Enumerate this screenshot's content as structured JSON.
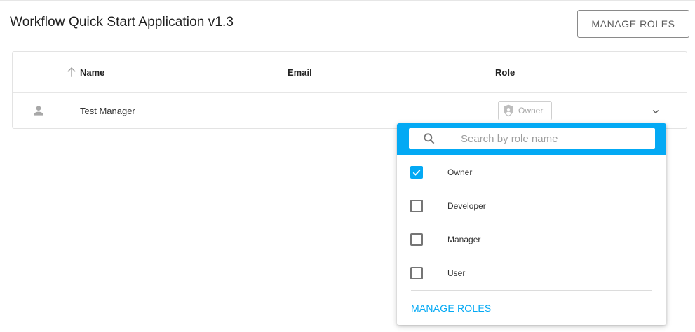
{
  "header": {
    "title": "Workflow Quick Start Application v1.3",
    "manage_roles_label": "MANAGE ROLES"
  },
  "table": {
    "columns": [
      "Name",
      "Email",
      "Role"
    ],
    "sort": {
      "column": "Name",
      "direction": "ascending",
      "icon": "arrow-up-icon"
    },
    "rows": [
      {
        "avatar_icon": "person-icon",
        "name": "Test Manager",
        "email": "",
        "role": "Owner",
        "role_icon": "shield-person-icon"
      }
    ]
  },
  "role_dropdown": {
    "search_placeholder": "Search by role name",
    "search_value": "",
    "options": [
      {
        "label": "Owner",
        "checked": true
      },
      {
        "label": "Developer",
        "checked": false
      },
      {
        "label": "Manager",
        "checked": false
      },
      {
        "label": "User",
        "checked": false
      }
    ],
    "footer_label": "MANAGE ROLES"
  },
  "colors": {
    "accent": "#03a9f4",
    "text": "#212121",
    "muted": "#a5a5a5"
  }
}
